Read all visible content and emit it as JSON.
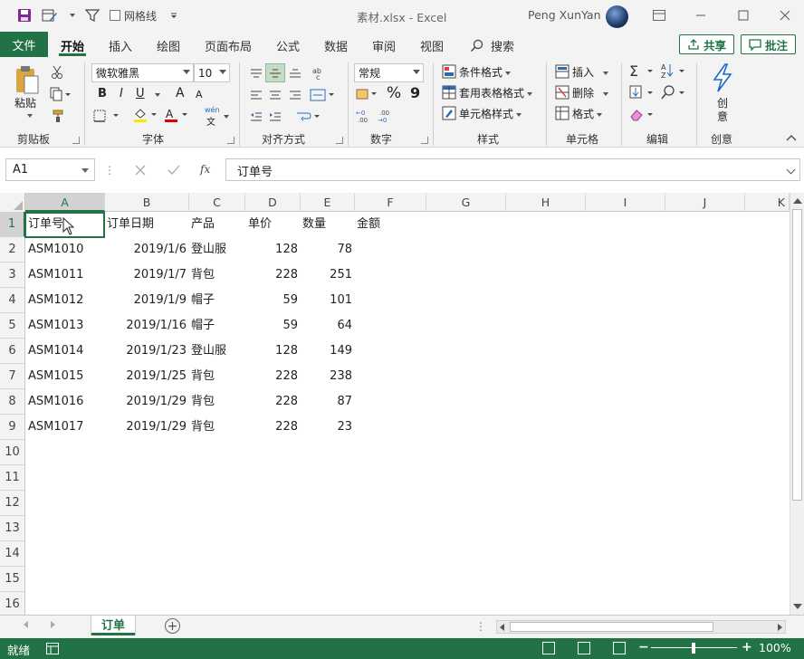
{
  "titlebar": {
    "gridlines_label": "网格线",
    "doc_title": "素材.xlsx  -  Excel",
    "user_name": "Peng XunYan"
  },
  "tabs": {
    "file": "文件",
    "items": [
      "开始",
      "插入",
      "绘图",
      "页面布局",
      "公式",
      "数据",
      "审阅",
      "视图"
    ],
    "active": "开始",
    "search": "搜索",
    "share": "共享",
    "comment": "批注"
  },
  "ribbon": {
    "clipboard": {
      "label": "剪贴板",
      "paste": "粘贴"
    },
    "font": {
      "label": "字体",
      "font_name": "微软雅黑",
      "font_size": "10",
      "bold": "B",
      "italic": "I",
      "underline": "U",
      "grow": "A",
      "shrink": "A",
      "phonetic_top": "wén",
      "phonetic_bottom": "文"
    },
    "alignment": {
      "label": "对齐方式"
    },
    "number": {
      "label": "数字",
      "format": "常规",
      "percent": "%",
      "comma": "9"
    },
    "styles": {
      "label": "样式",
      "conditional": "条件格式",
      "table": "套用表格格式",
      "cell_styles": "单元格样式"
    },
    "cells": {
      "label": "单元格",
      "insert": "插入",
      "delete": "删除",
      "format": "格式"
    },
    "editing": {
      "label": "编辑"
    },
    "create": {
      "label": "创意",
      "button_line1": "创",
      "button_line2": "意"
    }
  },
  "formula_bar": {
    "name_box": "A1",
    "fx": "fx",
    "content": "订单号"
  },
  "grid": {
    "columns": [
      "A",
      "B",
      "C",
      "D",
      "E",
      "F",
      "G",
      "H",
      "I",
      "J",
      "K"
    ],
    "rows": [
      "1",
      "2",
      "3",
      "4",
      "5",
      "6",
      "7",
      "8",
      "9",
      "10",
      "11",
      "12",
      "13",
      "14",
      "15",
      "16"
    ],
    "header": [
      "订单号",
      "订单日期",
      "产品",
      "单价",
      "数量",
      "金额"
    ],
    "data": [
      [
        "ASM1010",
        "2019/1/6",
        "登山服",
        "128",
        "78"
      ],
      [
        "ASM1011",
        "2019/1/7",
        "背包",
        "228",
        "251"
      ],
      [
        "ASM1012",
        "2019/1/9",
        "帽子",
        "59",
        "101"
      ],
      [
        "ASM1013",
        "2019/1/16",
        "帽子",
        "59",
        "64"
      ],
      [
        "ASM1014",
        "2019/1/23",
        "登山服",
        "128",
        "149"
      ],
      [
        "ASM1015",
        "2019/1/25",
        "背包",
        "228",
        "238"
      ],
      [
        "ASM1016",
        "2019/1/29",
        "背包",
        "228",
        "87"
      ],
      [
        "ASM1017",
        "2019/1/29",
        "背包",
        "228",
        "23"
      ]
    ]
  },
  "sheets": {
    "tabs": [
      "订单"
    ],
    "active": "订单"
  },
  "statusbar": {
    "status": "就绪",
    "zoom": "100%"
  },
  "colors": {
    "accent": "#217346",
    "header_bg": "#f3f3f3"
  }
}
